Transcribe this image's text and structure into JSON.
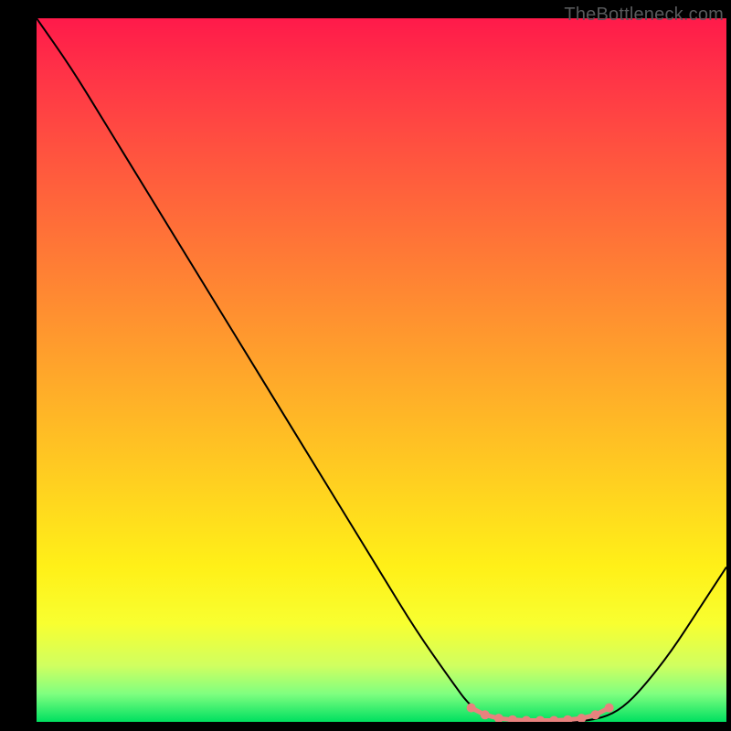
{
  "watermark": "TheBottleneck.com",
  "chart_data": {
    "type": "line",
    "title": "",
    "xlabel": "",
    "ylabel": "",
    "xlim": [
      0,
      100
    ],
    "ylim": [
      0,
      100
    ],
    "background_gradient": {
      "top": "#ff1a4a",
      "middle": "#ffd020",
      "bottom": "#00e060"
    },
    "series": [
      {
        "name": "bottleneck-curve",
        "color": "#000000",
        "x": [
          0,
          5,
          10,
          15,
          20,
          25,
          30,
          35,
          40,
          45,
          50,
          55,
          60,
          63,
          66,
          70,
          74,
          78,
          82,
          85,
          88,
          92,
          96,
          100
        ],
        "y": [
          100,
          93,
          85,
          77,
          69,
          61,
          53,
          45,
          37,
          29,
          21,
          13,
          6,
          2,
          0.5,
          0,
          0,
          0,
          0.5,
          2,
          5,
          10,
          16,
          22
        ]
      },
      {
        "name": "optimal-range-markers",
        "color": "#e57373",
        "type": "scatter",
        "x": [
          63,
          65,
          67,
          69,
          71,
          73,
          75,
          77,
          79,
          81,
          83
        ],
        "y": [
          2,
          1,
          0.5,
          0.3,
          0.2,
          0.2,
          0.2,
          0.3,
          0.5,
          1,
          2
        ]
      }
    ]
  }
}
